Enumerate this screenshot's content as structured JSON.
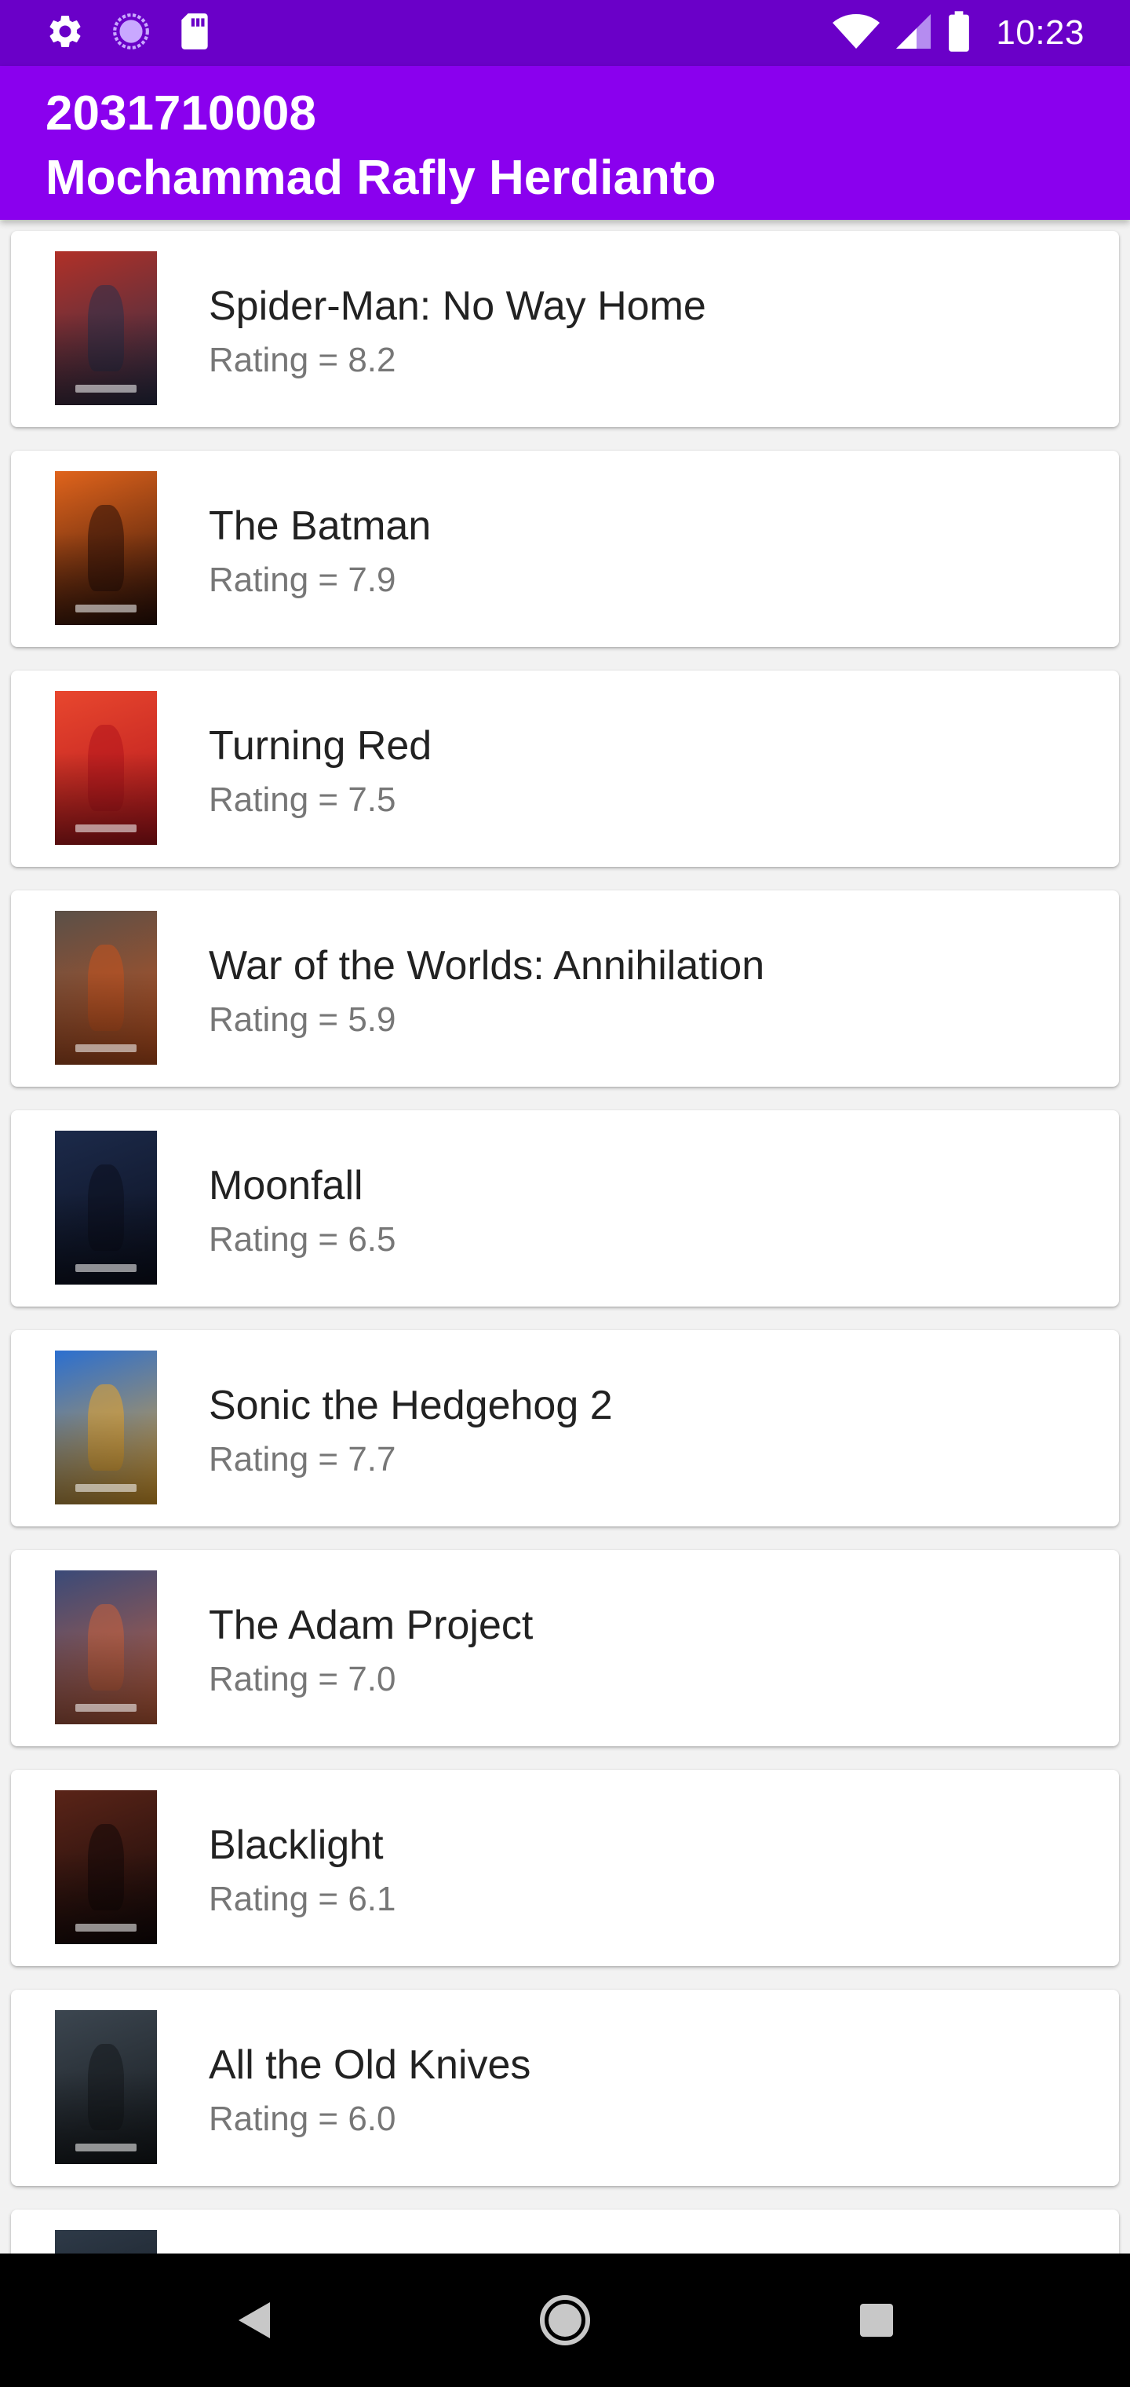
{
  "status_bar": {
    "time": "10:23",
    "left_icons": [
      "settings-icon",
      "sync-icon",
      "sd-card-icon"
    ],
    "right_icons": [
      "wifi-icon",
      "signal-icon",
      "battery-icon"
    ]
  },
  "app_bar": {
    "line1": "2031710008",
    "line2": "Mochammad Rafly Herdianto"
  },
  "movies": [
    {
      "title": "Spider-Man: No Way Home",
      "rating": "Rating = 8.2",
      "poster_colors": [
        "#b03028",
        "#2a2f4a"
      ]
    },
    {
      "title": "The Batman",
      "rating": "Rating = 7.9",
      "poster_colors": [
        "#e0641c",
        "#2a0f08"
      ]
    },
    {
      "title": "Turning Red",
      "rating": "Rating = 7.5",
      "poster_colors": [
        "#e8472e",
        "#b3141c"
      ]
    },
    {
      "title": "War of the Worlds: Annihilation",
      "rating": "Rating = 5.9",
      "poster_colors": [
        "#5a5048",
        "#c4521e"
      ]
    },
    {
      "title": "Moonfall",
      "rating": "Rating = 6.5",
      "poster_colors": [
        "#1c2a4a",
        "#0b0f1e"
      ]
    },
    {
      "title": "Sonic the Hedgehog 2",
      "rating": "Rating = 7.7",
      "poster_colors": [
        "#2b6fd0",
        "#e8a42a"
      ]
    },
    {
      "title": "The Adam Project",
      "rating": "Rating = 7.0",
      "poster_colors": [
        "#3a4a78",
        "#c8603a"
      ]
    },
    {
      "title": "Blacklight",
      "rating": "Rating = 6.1",
      "poster_colors": [
        "#5a2418",
        "#120808"
      ]
    },
    {
      "title": "All the Old Knives",
      "rating": "Rating = 6.0",
      "poster_colors": [
        "#3c4650",
        "#14181c"
      ]
    },
    {
      "title": "",
      "rating": "",
      "poster_colors": [
        "#2e3a48",
        "#10141a"
      ]
    }
  ],
  "nav_bar": {
    "icons": [
      "back-icon",
      "home-icon",
      "recents-icon"
    ]
  },
  "colors": {
    "status_bar": "#6a00c8",
    "app_bar": "#8a00ee",
    "list_background": "#f2f2f2",
    "title_text": "#222222",
    "rating_text": "#777777"
  }
}
